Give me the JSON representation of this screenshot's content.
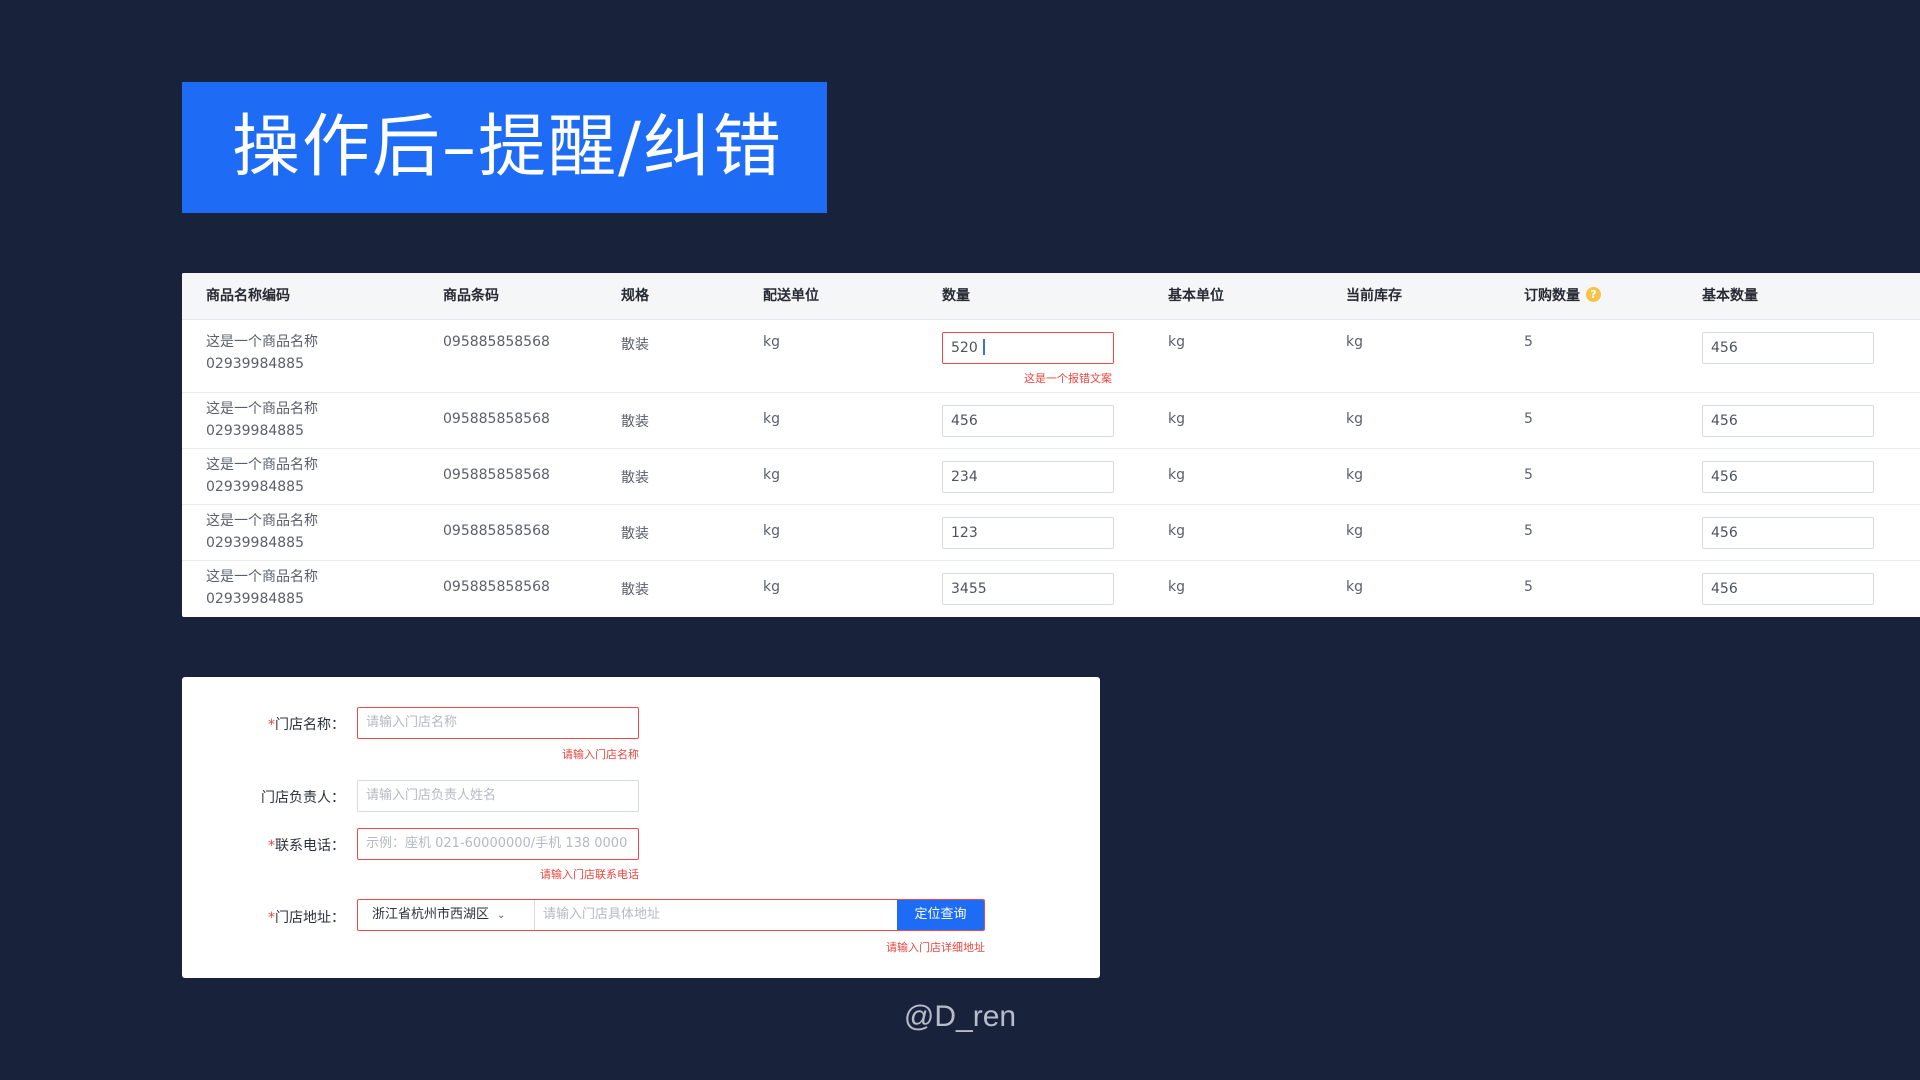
{
  "title": "操作后–提醒/纠错",
  "table": {
    "headers": [
      "商品名称编码",
      "商品条码",
      "规格",
      "配送单位",
      "数量",
      "基本单位",
      "当前库存",
      "订购数量",
      "基本数量"
    ],
    "help_icon": "?",
    "rows": [
      {
        "name": "这是一个商品名称",
        "code": "02939984885",
        "barcode": "095885858568",
        "spec": "散装",
        "delivery_unit": "kg",
        "quantity": "520",
        "base_unit": "kg",
        "stock": "kg",
        "order_qty": "5",
        "base_qty": "456",
        "error": "这是一个报错文案"
      },
      {
        "name": "这是一个商品名称",
        "code": "02939984885",
        "barcode": "095885858568",
        "spec": "散装",
        "delivery_unit": "kg",
        "quantity": "456",
        "base_unit": "kg",
        "stock": "kg",
        "order_qty": "5",
        "base_qty": "456"
      },
      {
        "name": "这是一个商品名称",
        "code": "02939984885",
        "barcode": "095885858568",
        "spec": "散装",
        "delivery_unit": "kg",
        "quantity": "234",
        "base_unit": "kg",
        "stock": "kg",
        "order_qty": "5",
        "base_qty": "456"
      },
      {
        "name": "这是一个商品名称",
        "code": "02939984885",
        "barcode": "095885858568",
        "spec": "散装",
        "delivery_unit": "kg",
        "quantity": "123",
        "base_unit": "kg",
        "stock": "kg",
        "order_qty": "5",
        "base_qty": "456"
      },
      {
        "name": "这是一个商品名称",
        "code": "02939984885",
        "barcode": "095885858568",
        "spec": "散装",
        "delivery_unit": "kg",
        "quantity": "3455",
        "base_unit": "kg",
        "stock": "kg",
        "order_qty": "5",
        "base_qty": "456"
      }
    ]
  },
  "form": {
    "store_name": {
      "required_mark": "*",
      "label": "门店名称：",
      "placeholder": "请输入门店名称",
      "error": "请输入门店名称"
    },
    "manager": {
      "label": "门店负责人：",
      "placeholder": "请输入门店负责人姓名"
    },
    "phone": {
      "required_mark": "*",
      "label": "联系电话：",
      "placeholder": "示例：座机 021-60000000/手机 138 0000",
      "error": "请输入门店联系电话"
    },
    "address": {
      "required_mark": "*",
      "label": "门店地址：",
      "region": "浙江省杭州市西湖区",
      "chevron": "⌄",
      "placeholder": "请输入门店具体地址",
      "button": "定位查询",
      "error": "请输入门店详细地址"
    }
  },
  "watermark": "@D_ren",
  "colors": {
    "background": "#18223b",
    "accent": "#1e6cf5",
    "error": "#ef4a4a",
    "help": "#f5c24a"
  }
}
